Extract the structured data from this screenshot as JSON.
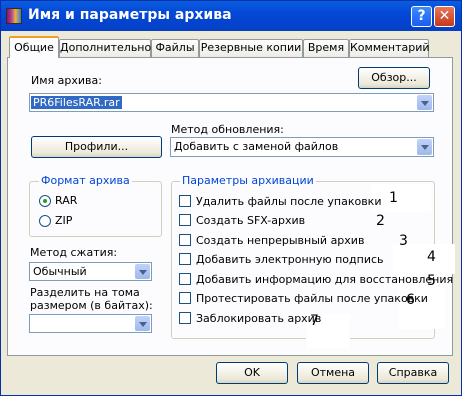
{
  "window": {
    "title": "Имя и параметры архива",
    "help_label": "?",
    "close_label": "✕"
  },
  "tabs": [
    {
      "label": "Общие",
      "active": true
    },
    {
      "label": "Дополнительно",
      "active": false
    },
    {
      "label": "Файлы",
      "active": false
    },
    {
      "label": "Резервные копии",
      "active": false
    },
    {
      "label": "Время",
      "active": false
    },
    {
      "label": "Комментарий",
      "active": false
    }
  ],
  "general": {
    "archive_name_label": "Имя архива:",
    "browse_button": "Обзор...",
    "archive_name_value": "PR6FilesRAR.rar",
    "update_method_label": "Метод обновления:",
    "update_method_value": "Добавить с заменой файлов",
    "profiles_button": "Профили...",
    "format_group": "Формат архива",
    "format_options": [
      {
        "label": "RAR",
        "selected": true
      },
      {
        "label": "ZIP",
        "selected": false
      }
    ],
    "compression_label": "Метод сжатия:",
    "compression_value": "Обычный",
    "split_label_line1": "Разделить на тома",
    "split_label_line2": "размером (в байтах):",
    "split_value": "",
    "options_group": "Параметры архивации",
    "options": [
      {
        "label": "Удалить файлы после упаковки",
        "checked": false
      },
      {
        "label": "Создать SFX-архив",
        "checked": false
      },
      {
        "label": "Создать непрерывный архив",
        "checked": false
      },
      {
        "label": "Добавить электронную подпись",
        "checked": false
      },
      {
        "label": "Добавить информацию для восстановления",
        "checked": false
      },
      {
        "label": "Протестировать файлы после упаковки",
        "checked": false
      },
      {
        "label": "Заблокировать архив",
        "checked": false
      }
    ],
    "annotations": [
      "1",
      "2",
      "3",
      "4",
      "5",
      "6",
      "7"
    ]
  },
  "footer": {
    "ok": "OK",
    "cancel": "Отмена",
    "help": "Справка"
  },
  "icons": [
    "winrar-app-icon",
    "help-icon",
    "close-icon",
    "chevron-down-icon"
  ],
  "colors": {
    "titlebar": "#0a5ee0",
    "dialog": "#ece9d8",
    "group_legend": "#0046d5",
    "selection": "#316ac5"
  }
}
